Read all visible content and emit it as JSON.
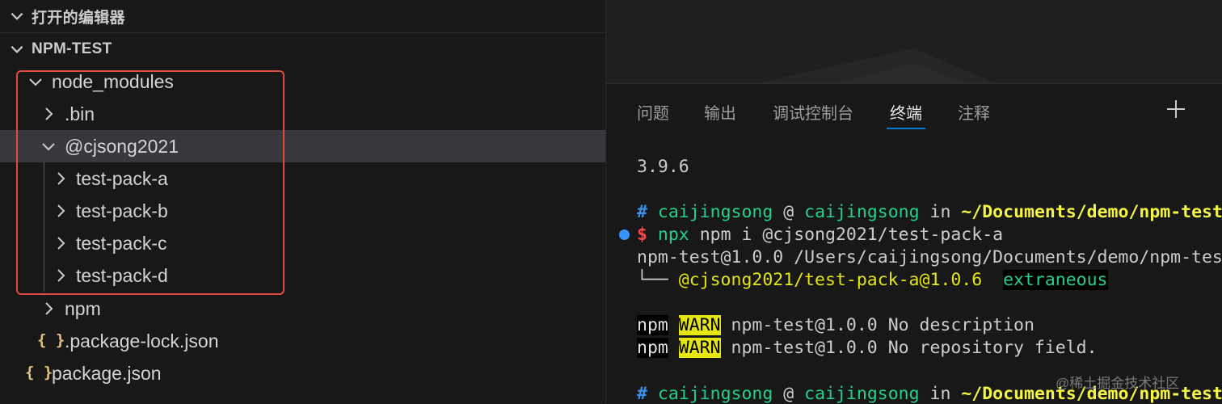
{
  "explorer": {
    "open_editors_title": "打开的编辑器",
    "project_title": "NPM-TEST",
    "tree": [
      {
        "label": "node_modules",
        "type": "folder",
        "expanded": true
      },
      {
        "label": ".bin",
        "type": "folder",
        "expanded": false
      },
      {
        "label": "@cjsong2021",
        "type": "folder",
        "expanded": true,
        "selected": true
      },
      {
        "label": "test-pack-a",
        "type": "folder",
        "expanded": false
      },
      {
        "label": "test-pack-b",
        "type": "folder",
        "expanded": false
      },
      {
        "label": "test-pack-c",
        "type": "folder",
        "expanded": false
      },
      {
        "label": "test-pack-d",
        "type": "folder",
        "expanded": false
      },
      {
        "label": "npm",
        "type": "folder",
        "expanded": false
      },
      {
        "label": ".package-lock.json",
        "type": "json",
        "icon": "{ }"
      },
      {
        "label": "package.json",
        "type": "json",
        "icon": "{ }"
      }
    ]
  },
  "panel": {
    "tabs": [
      "问题",
      "输出",
      "调试控制台",
      "终端",
      "注释"
    ],
    "active_tab": "终端",
    "add_icon": "plus-icon",
    "terminal": {
      "version_line": "3.9.6",
      "prompt1": {
        "hash": "#",
        "user": "caijingsong",
        "at": "@",
        "host": "caijingsong",
        "in": "in",
        "path": "~/Documents/demo/npm-test"
      },
      "command": {
        "dollar": "$",
        "npx": "npx",
        "rest": "npm i @cjsong2021/test-pack-a"
      },
      "out_line": "npm-test@1.0.0 /Users/caijingsong/Documents/demo/npm-tes",
      "tree_prefix": "└── ",
      "tree_pkg": "@cjsong2021/test-pack-a@1.0.6",
      "tree_status": "extraneous",
      "warn1": {
        "npm": "npm",
        "warn": "WARN",
        "msg": "npm-test@1.0.0 No description"
      },
      "warn2": {
        "npm": "npm",
        "warn": "WARN",
        "msg": "npm-test@1.0.0 No repository field."
      },
      "prompt2": {
        "hash": "#",
        "user": "caijingsong",
        "at": "@",
        "host": "caijingsong",
        "in": "in",
        "path": "~/Documents/demo/npm-test"
      }
    }
  },
  "watermark": "@稀土掘金技术社区",
  "colors": {
    "accent": "#0078d4",
    "highlight_box": "#e04b3c",
    "json_icon": "#e5c07b"
  }
}
